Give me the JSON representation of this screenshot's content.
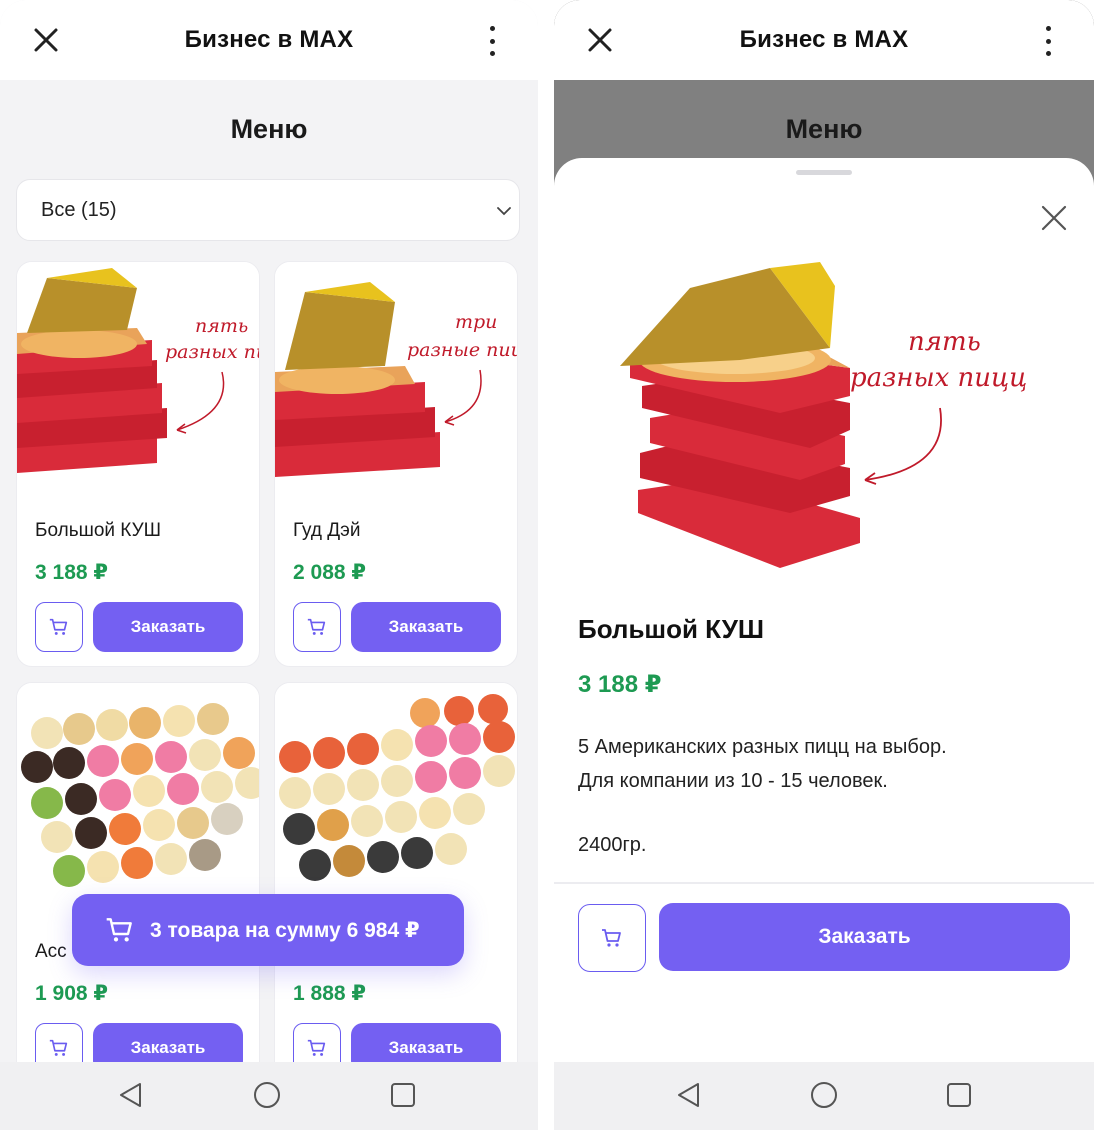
{
  "app": {
    "title": "Бизнес в MAX"
  },
  "menu": {
    "page_title": "Меню",
    "filter_label": "Все (15)",
    "items": [
      {
        "name": "Большой КУШ",
        "price": "3 188 ₽",
        "order_label": "Заказать",
        "image_caption_line1": "пять",
        "image_caption_line2": "разных пи"
      },
      {
        "name": "Гуд Дэй",
        "price": "2 088 ₽",
        "order_label": "Заказать",
        "image_caption_line1": "три",
        "image_caption_line2": "разные пиц"
      },
      {
        "name": "Асс",
        "price": "1 908 ₽",
        "order_label": "Заказать"
      },
      {
        "name": "",
        "price": "1 888 ₽",
        "order_label": "Заказать"
      }
    ],
    "cart_summary": "3 товара на сумму 6 984 ₽"
  },
  "detail": {
    "page_title": "Меню",
    "title": "Большой КУШ",
    "price": "3 188 ₽",
    "description_line1": "5 Американских разных пицц на выбор.",
    "description_line2": "Для компании из 10 - 15 человек.",
    "weight": "2400гр.",
    "order_label": "Заказать",
    "image_caption_line1": "пять",
    "image_caption_line2": "разных пицц"
  },
  "colors": {
    "accent": "#7460f2",
    "price_green": "#1d9a52",
    "pizza_box_red": "#d92b3a",
    "pizza_box_yellow": "#e8c21e"
  },
  "icons": [
    "close-icon",
    "more-vertical-icon",
    "chevron-down-icon",
    "cart-icon",
    "nav-back-icon",
    "nav-home-icon",
    "nav-recent-icon"
  ]
}
